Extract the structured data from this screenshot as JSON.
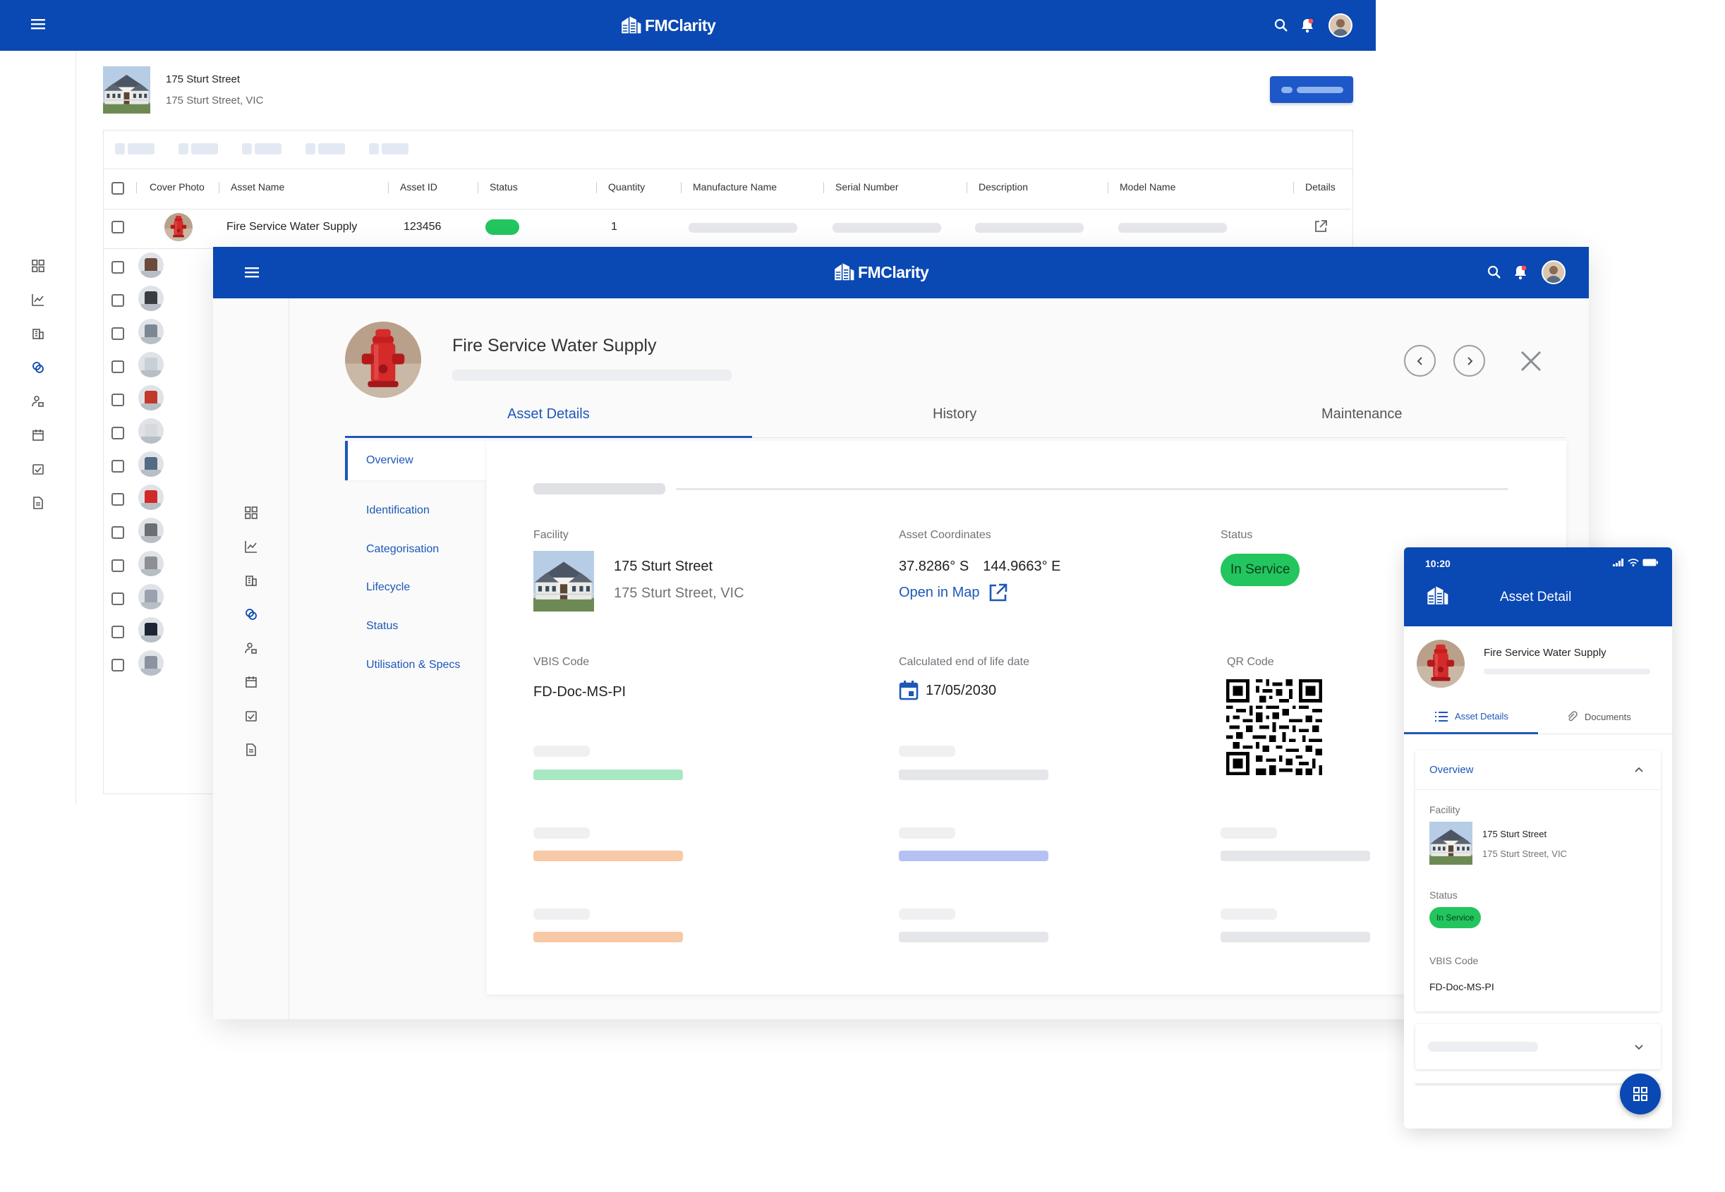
{
  "brand": {
    "name": "FMClarity",
    "accent": "#0a48b3"
  },
  "list_view": {
    "facility_name": "175 Sturt Street",
    "facility_address": "175 Sturt Street, VIC",
    "columns": [
      "Cover Photo",
      "Asset Name",
      "Asset ID",
      "Status",
      "Quantity",
      "Manufacture Name",
      "Serial Number",
      "Description",
      "Model Name",
      "Details"
    ],
    "first_row": {
      "asset_name": "Fire Service Water Supply",
      "asset_id": "123456",
      "quantity": "1",
      "status_color": "#22c55e"
    },
    "row_count": 14
  },
  "detail_view": {
    "asset_name": "Fire Service Water Supply",
    "tabs": [
      "Asset Details",
      "History",
      "Maintenance"
    ],
    "active_tab": "Asset Details",
    "side_nav": [
      "Overview",
      "Identification",
      "Categorisation",
      "Lifecycle",
      "Status",
      "Utilisation & Specs"
    ],
    "active_side": "Overview",
    "facility": {
      "label": "Facility",
      "name": "175 Sturt Street",
      "address": "175 Sturt Street, VIC"
    },
    "coordinates": {
      "label": "Asset Coordinates",
      "lat": "37.8286° S",
      "lon": "144.9663° E",
      "map_link": "Open in Map"
    },
    "status": {
      "label": "Status",
      "value": "In Service",
      "color": "#22c55e"
    },
    "vbis": {
      "label": "VBIS Code",
      "value": "FD-Doc-MS-PI"
    },
    "end_of_life": {
      "label": "Calculated end of life date",
      "value": "17/05/2030"
    },
    "qr": {
      "label": "QR Code"
    }
  },
  "mobile": {
    "time": "10:20",
    "title": "Asset Detail",
    "asset_name": "Fire Service Water Supply",
    "tabs": [
      "Asset Details",
      "Documents"
    ],
    "section": "Overview",
    "facility_label": "Facility",
    "facility_name": "175 Sturt Street",
    "facility_address": "175 Sturt Street, VIC",
    "status_label": "Status",
    "status_value": "In Service",
    "vbis_label": "VBIS Code",
    "vbis_value": "FD-Doc-MS-PI"
  },
  "icons": [
    "menu-icon",
    "search-icon",
    "bell-icon",
    "avatar",
    "dashboard-icon",
    "chart-icon",
    "building-icon",
    "assets-icon",
    "people-icon",
    "calendar-icon",
    "checklist-icon",
    "document-icon",
    "external-link-icon",
    "chevron-left-icon",
    "chevron-right-icon",
    "close-icon",
    "calendar-date-icon",
    "list-icon",
    "paperclip-icon",
    "chevron-up-icon",
    "chevron-down-icon",
    "grid-icon"
  ]
}
